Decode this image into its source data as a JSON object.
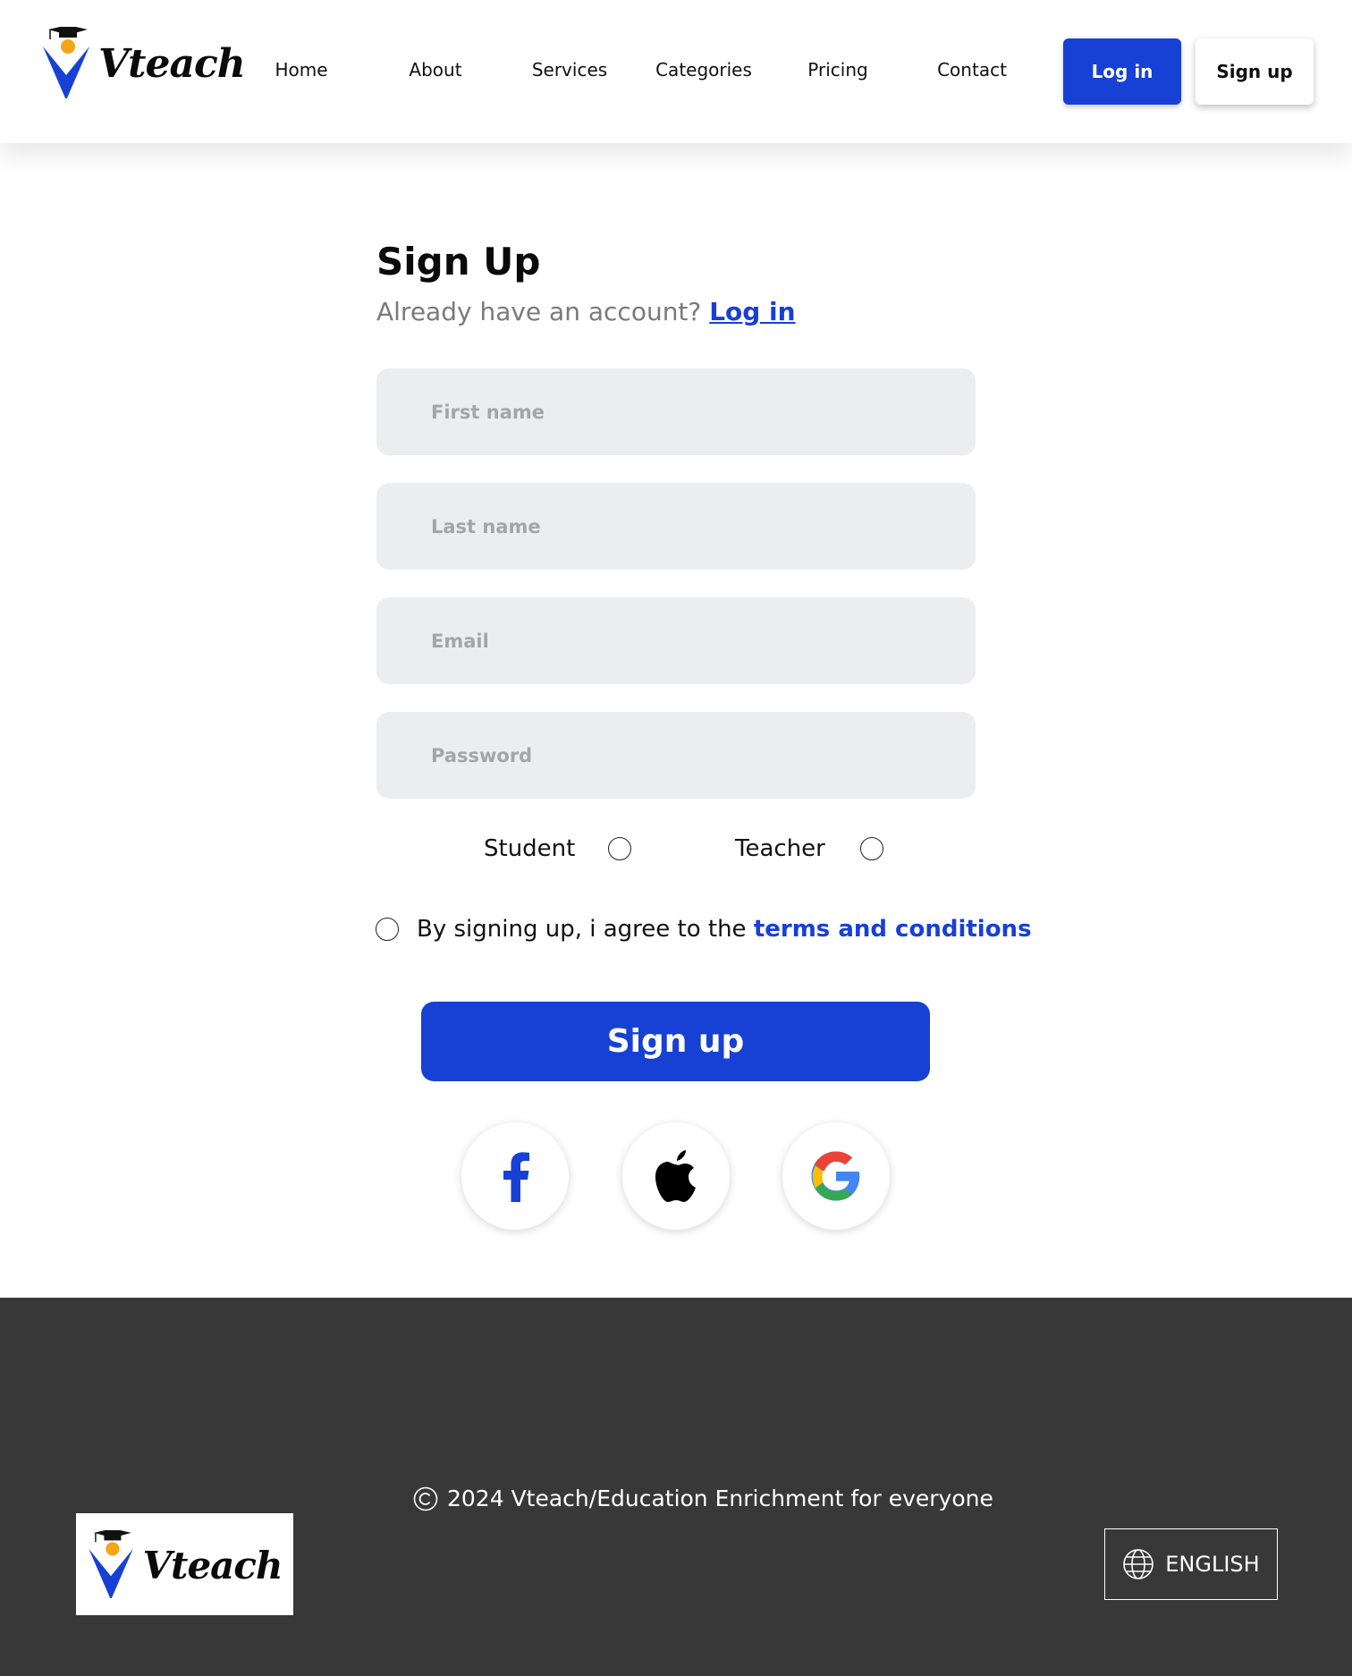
{
  "brand": {
    "name": "Vteach"
  },
  "nav": {
    "links": [
      "Home",
      "About",
      "Services",
      "Categories",
      "Pricing",
      "Contact"
    ],
    "login_label": "Log in",
    "signup_label": "Sign up"
  },
  "form": {
    "title": "Sign Up",
    "subtitle": "Already have an account?",
    "login_link": "Log in",
    "first_name_placeholder": "First name",
    "last_name_placeholder": "Last name",
    "email_placeholder": "Email",
    "password_placeholder": "Password",
    "role_student": "Student",
    "role_teacher": "Teacher",
    "agree_text": "By signing up, i agree to the",
    "terms_link": "terms and conditions",
    "submit_label": "Sign up"
  },
  "social": {
    "icons": [
      "facebook-icon",
      "apple-icon",
      "google-icon"
    ],
    "facebook_color": "#1740d5"
  },
  "footer": {
    "copyright": "2024 Vteach/Education Enrichment for everyone",
    "language": "ENGLISH"
  },
  "colors": {
    "accent": "#1740d5",
    "field_bg": "#ecedf0",
    "footer_bg": "#383838",
    "logo_orange": "#f5a515"
  }
}
